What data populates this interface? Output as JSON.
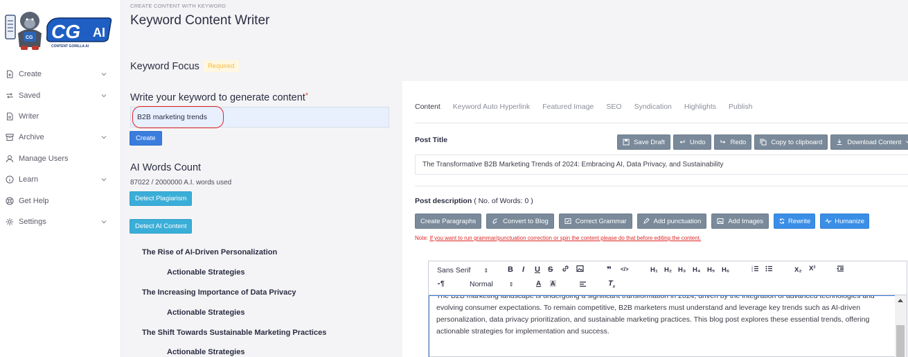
{
  "brand": {
    "logo_text": "CG",
    "logo_ai": "AI",
    "tagline": "CONTENT GORILLA AI"
  },
  "sidebar": {
    "items": [
      {
        "label": "Create",
        "icon": "file-plus-icon",
        "has_chevron": true
      },
      {
        "label": "Saved",
        "icon": "repeat-icon",
        "has_chevron": true
      },
      {
        "label": "Writer",
        "icon": "file-text-icon",
        "has_chevron": false
      },
      {
        "label": "Archive",
        "icon": "archive-icon",
        "has_chevron": true
      },
      {
        "label": "Manage Users",
        "icon": "user-icon",
        "has_chevron": false
      },
      {
        "label": "Learn",
        "icon": "info-icon",
        "has_chevron": true
      },
      {
        "label": "Get Help",
        "icon": "lifebuoy-icon",
        "has_chevron": false
      },
      {
        "label": "Settings",
        "icon": "gear-icon",
        "has_chevron": true
      }
    ]
  },
  "header": {
    "eyebrow": "CREATE CONTENT WITH KEYWORD",
    "title": "Keyword Content Writer"
  },
  "keyword_panel": {
    "section_title": "Keyword Focus",
    "required_badge": "Required",
    "input_label": "Write your keyword to generate content",
    "required_mark": "*",
    "input_value": "B2B marketing trends",
    "create_button": "Create",
    "words_title": "AI Words Count",
    "words_used": "87022 / 2000000 A.I. words used",
    "detect_plagiarism": "Detect Plagiarism",
    "detect_ai": "Detect AI Content"
  },
  "outline": [
    {
      "text": "The Rise of AI-Driven Personalization",
      "level": 1
    },
    {
      "text": "Actionable Strategies",
      "level": 2
    },
    {
      "text": "The Increasing Importance of Data Privacy",
      "level": 1
    },
    {
      "text": "Actionable Strategies",
      "level": 2
    },
    {
      "text": "The Shift Towards Sustainable Marketing Practices",
      "level": 1
    },
    {
      "text": "Actionable Strategies",
      "level": 2
    }
  ],
  "tabs": [
    "Content",
    "Keyword Auto Hyperlink",
    "Featured Image",
    "SEO",
    "Syndication",
    "Highlights",
    "Publish"
  ],
  "post": {
    "title_label": "Post Title",
    "title_value": "The Transformative B2B Marketing Trends of 2024: Embracing AI, Data Privacy, and Sustainability",
    "desc_label": "Post description",
    "desc_count": "( No. of Words: 0 )",
    "note_prefix": "Note:",
    "note_text": "If you want to run grammar/punctuation correction or spin the content please do that before editing the content."
  },
  "toolbar1": [
    "Save Draft",
    "Undo",
    "Redo",
    "Copy to clipboard",
    "Download Content"
  ],
  "toolbar2": {
    "grey": [
      "Create Paragraphs",
      "Convert to Blog",
      "Correct Grammar",
      "Add punctuation",
      "Add Images"
    ],
    "blue": [
      "Rewrite",
      "Humanize"
    ]
  },
  "editor": {
    "font": "Sans Serif",
    "size": "Normal",
    "body": "The B2B marketing landscape is undergoing a significant transformation in 2024, driven by the integration of advanced technologies and evolving consumer expectations. To remain competitive, B2B marketers must understand and leverage key trends such as AI-driven personalization, data privacy prioritization, and sustainable marketing practices. This blog post explores these essential trends, offering actionable strategies for implementation and success."
  },
  "colors": {
    "primary": "#3b7ddd",
    "teal": "#3aaed8",
    "grey_button": "#7a8a9a",
    "required": "#f5bd3f",
    "error": "#e02424"
  }
}
